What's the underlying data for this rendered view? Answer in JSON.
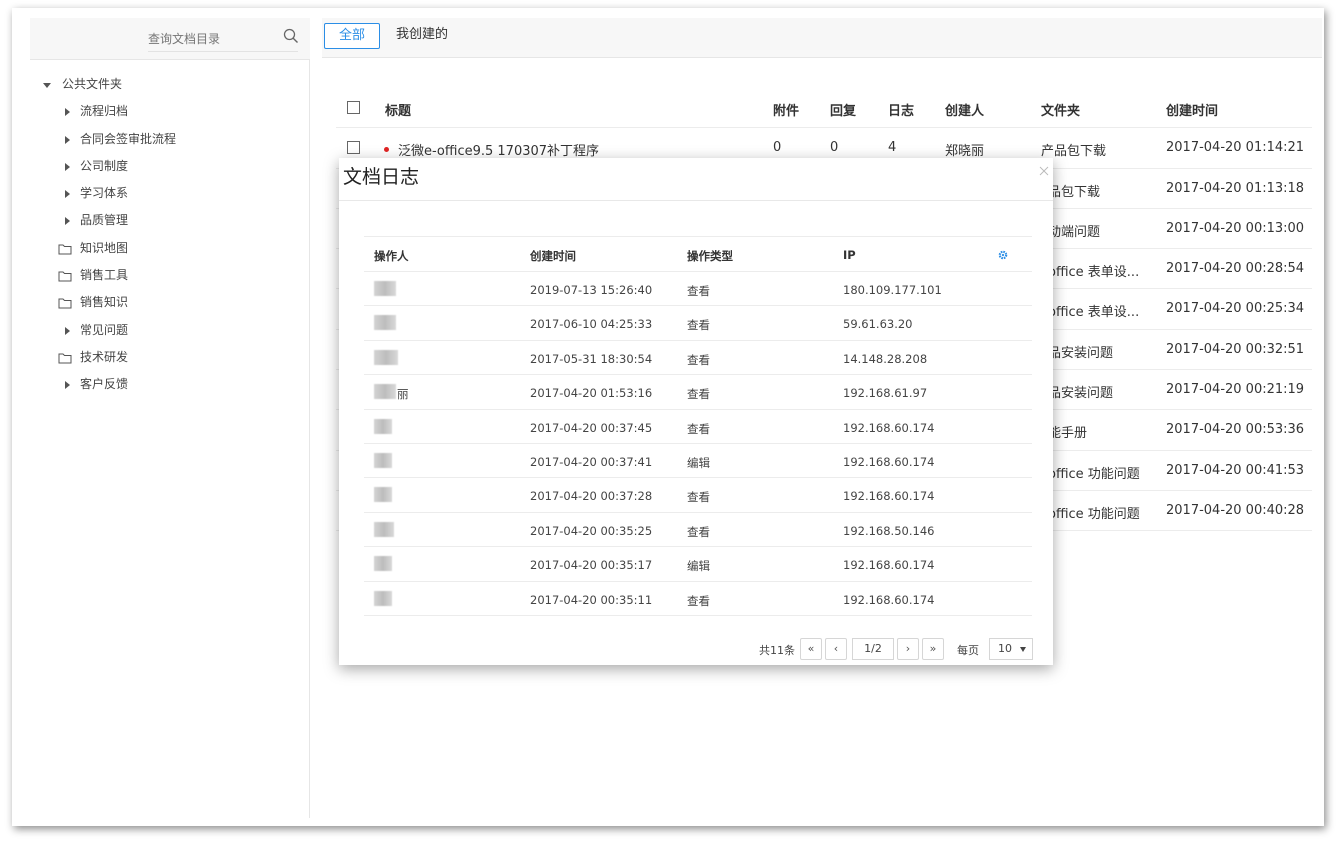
{
  "search": {
    "placeholder": "查询文档目录"
  },
  "tree": [
    {
      "label": "公共文件夹",
      "type": "expanded",
      "level": 0
    },
    {
      "label": "流程归档",
      "type": "collapsed",
      "level": 1
    },
    {
      "label": "合同会签审批流程",
      "type": "collapsed",
      "level": 1
    },
    {
      "label": "公司制度",
      "type": "collapsed",
      "level": 1
    },
    {
      "label": "学习体系",
      "type": "collapsed",
      "level": 1
    },
    {
      "label": "品质管理",
      "type": "collapsed",
      "level": 1
    },
    {
      "label": "知识地图",
      "type": "folder",
      "level": 0
    },
    {
      "label": "销售工具",
      "type": "folder",
      "level": 0
    },
    {
      "label": "销售知识",
      "type": "folder",
      "level": 0
    },
    {
      "label": "常见问题",
      "type": "collapsed",
      "level": 1
    },
    {
      "label": "技术研发",
      "type": "folder",
      "level": 0
    },
    {
      "label": "客户反馈",
      "type": "collapsed",
      "level": 1
    }
  ],
  "tabs": {
    "all": "全部",
    "mine": "我创建的"
  },
  "doc_table": {
    "headers": {
      "title": "标题",
      "attach": "附件",
      "reply": "回复",
      "log": "日志",
      "creator": "创建人",
      "folder": "文件夹",
      "created": "创建时间"
    },
    "first_row": {
      "title": "泛微e-office9.5 170307补丁程序",
      "attach": "0",
      "reply": "0",
      "log": "4",
      "creator": "郑晓丽"
    },
    "rows": [
      {
        "folder": "产品包下载",
        "created": "2017-04-20 01:14:21"
      },
      {
        "folder": "品包下载",
        "created": "2017-04-20 01:13:18"
      },
      {
        "folder": "动端问题",
        "created": "2017-04-20 00:13:00"
      },
      {
        "folder": "office 表单设...",
        "created": "2017-04-20 00:28:54"
      },
      {
        "folder": "office 表单设...",
        "created": "2017-04-20 00:25:34"
      },
      {
        "folder": "品安装问题",
        "created": "2017-04-20 00:32:51"
      },
      {
        "folder": "品安装问题",
        "created": "2017-04-20 00:21:19"
      },
      {
        "folder": "能手册",
        "created": "2017-04-20 00:53:36"
      },
      {
        "folder": "office 功能问题",
        "created": "2017-04-20 00:41:53"
      },
      {
        "folder": "office 功能问题",
        "created": "2017-04-20 00:40:28"
      }
    ]
  },
  "modal": {
    "title": "文档日志",
    "headers": {
      "operator": "操作人",
      "created": "创建时间",
      "op_type": "操作类型",
      "ip": "IP"
    },
    "rows": [
      {
        "operator": "",
        "created": "2019-07-13 15:26:40",
        "op_type": "查看",
        "ip": "180.109.177.101"
      },
      {
        "operator": "",
        "created": "2017-06-10 04:25:33",
        "op_type": "查看",
        "ip": "59.61.63.20"
      },
      {
        "operator": "",
        "created": "2017-05-31 18:30:54",
        "op_type": "查看",
        "ip": "14.148.28.208"
      },
      {
        "operator": "丽",
        "created": "2017-04-20 01:53:16",
        "op_type": "查看",
        "ip": "192.168.61.97"
      },
      {
        "operator": "",
        "created": "2017-04-20 00:37:45",
        "op_type": "查看",
        "ip": "192.168.60.174"
      },
      {
        "operator": "",
        "created": "2017-04-20 00:37:41",
        "op_type": "编辑",
        "ip": "192.168.60.174"
      },
      {
        "operator": "",
        "created": "2017-04-20 00:37:28",
        "op_type": "查看",
        "ip": "192.168.60.174"
      },
      {
        "operator": "",
        "created": "2017-04-20 00:35:25",
        "op_type": "查看",
        "ip": "192.168.50.146"
      },
      {
        "operator": "",
        "created": "2017-04-20 00:35:17",
        "op_type": "编辑",
        "ip": "192.168.60.174"
      },
      {
        "operator": "",
        "created": "2017-04-20 00:35:11",
        "op_type": "查看",
        "ip": "192.168.60.174"
      }
    ],
    "pager": {
      "total": "共11条",
      "first": "«",
      "prev": "‹",
      "page": "1/2",
      "next": "›",
      "last": "»",
      "per_page_label": "每页",
      "per_page": "10"
    }
  },
  "colors": {
    "accent": "#2b8ee6",
    "dot": "#e02424"
  }
}
